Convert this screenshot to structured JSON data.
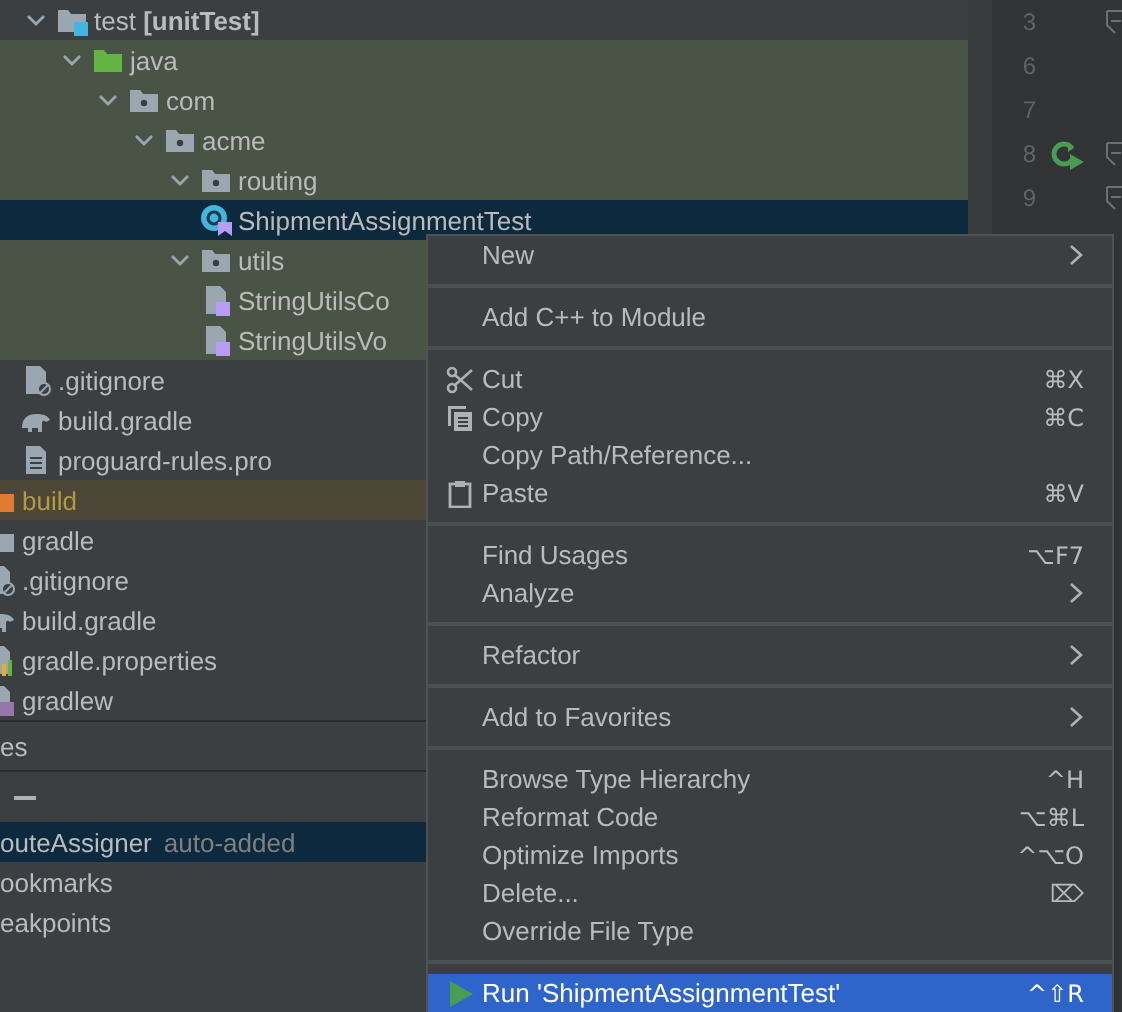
{
  "project_tree": {
    "items": [
      {
        "kind": "group",
        "children": [
          {
            "label": "test **[unitTest]**",
            "kind": "test-root",
            "expanded": true,
            "selected": false,
            "children": [
              {
                "label": "java",
                "kind": "source-folder",
                "expanded": true,
                "selected": false,
                "test_scope": true,
                "children": [
                  {
                    "label": "com",
                    "kind": "package",
                    "expanded": true,
                    "selected": false,
                    "test_scope": true,
                    "children": [
                      {
                        "label": "acme",
                        "kind": "package",
                        "expanded": true,
                        "selected": false,
                        "test_scope": true,
                        "children": [
                          {
                            "label": "routing",
                            "kind": "package",
                            "expanded": true,
                            "selected": false,
                            "test_scope": true,
                            "children": [
                              {
                                "label": "ShipmentAssignmentTest",
                                "kind": "test-class",
                                "selected": true
                              }
                            ]
                          },
                          {
                            "label": "utils",
                            "kind": "package",
                            "expanded": true,
                            "selected": false,
                            "test_scope": true,
                            "children": [
                              {
                                "label": "StringUtilsCo",
                                "kind": "kotlin-file",
                                "selected": false,
                                "test_scope": true
                              },
                              {
                                "label": "StringUtilsVo",
                                "kind": "kotlin-file",
                                "selected": false,
                                "test_scope": true
                              }
                            ]
                          }
                        ]
                      }
                    ]
                  }
                ]
              }
            ]
          },
          {
            "label": ".gitignore",
            "kind": "ignore-file",
            "selected": false
          },
          {
            "label": "build.gradle",
            "kind": "gradle-file",
            "selected": false
          },
          {
            "label": "proguard-rules.pro",
            "kind": "text-file",
            "selected": false
          }
        ]
      },
      {
        "label": "build",
        "kind": "folder",
        "selected": false,
        "excluded": true
      },
      {
        "label": "gradle",
        "kind": "folder",
        "selected": false
      },
      {
        "label": ".gitignore",
        "kind": "ignore-file",
        "selected": false
      },
      {
        "label": "build.gradle",
        "kind": "gradle-file",
        "selected": false
      },
      {
        "label": "gradle.properties",
        "kind": "properties-file",
        "selected": false
      },
      {
        "label": "gradlew",
        "kind": "script-file",
        "selected": false
      }
    ]
  },
  "bottom_panel": {
    "header": "es",
    "items": [
      {
        "label": "outeAssigner",
        "note": "auto-added",
        "selected": true
      },
      {
        "label": "ookmarks",
        "selected": false
      },
      {
        "label": "eakpoints",
        "selected": false
      }
    ]
  },
  "editor_gutter": {
    "lines": [
      {
        "number": "3",
        "fold": true,
        "run_marker": false
      },
      {
        "number": "6",
        "fold": false,
        "run_marker": false
      },
      {
        "number": "7",
        "fold": false,
        "run_marker": false
      },
      {
        "number": "8",
        "fold": true,
        "run_marker": true
      },
      {
        "number": "9",
        "fold": true,
        "run_marker": false
      }
    ]
  },
  "context_menu": {
    "groups": [
      [
        {
          "label": "New",
          "kind": "plain",
          "submenu": true,
          "selected": false
        }
      ],
      [
        {
          "label": "Add C++ to Module",
          "kind": "plain",
          "submenu": false,
          "selected": false
        }
      ],
      [
        {
          "label": "Cut",
          "kind": "cut",
          "shortcut": "⌘X",
          "submenu": false,
          "selected": false
        },
        {
          "label": "Copy",
          "kind": "copy",
          "shortcut": "⌘C",
          "submenu": false,
          "selected": false
        },
        {
          "label": "Copy Path/Reference...",
          "kind": "plain",
          "submenu": false,
          "selected": false
        },
        {
          "label": "Paste",
          "kind": "paste",
          "shortcut": "⌘V",
          "submenu": false,
          "selected": false
        }
      ],
      [
        {
          "label": "Find Usages",
          "kind": "plain",
          "shortcut": "⌥F7",
          "submenu": false,
          "selected": false
        },
        {
          "label": "Analyze",
          "kind": "plain",
          "submenu": true,
          "selected": false
        }
      ],
      [
        {
          "label": "Refactor",
          "kind": "plain",
          "submenu": true,
          "selected": false
        }
      ],
      [
        {
          "label": "Add to Favorites",
          "kind": "plain",
          "submenu": true,
          "selected": false
        }
      ],
      [
        {
          "label": "Browse Type Hierarchy",
          "kind": "plain",
          "shortcut": "^H",
          "submenu": false,
          "selected": false
        },
        {
          "label": "Reformat Code",
          "kind": "plain",
          "shortcut": "⌥⌘L",
          "submenu": false,
          "selected": false
        },
        {
          "label": "Optimize Imports",
          "kind": "plain",
          "shortcut": "^⌥O",
          "submenu": false,
          "selected": false
        },
        {
          "label": "Delete...",
          "kind": "plain",
          "shortcut": "⌦",
          "submenu": false,
          "selected": false
        },
        {
          "label": "Override File Type",
          "kind": "plain",
          "submenu": false,
          "selected": false
        }
      ],
      [
        {
          "label": "Run 'ShipmentAssignmentTest'",
          "kind": "run",
          "shortcut": "^⇧R",
          "submenu": false,
          "selected": true
        }
      ]
    ]
  }
}
